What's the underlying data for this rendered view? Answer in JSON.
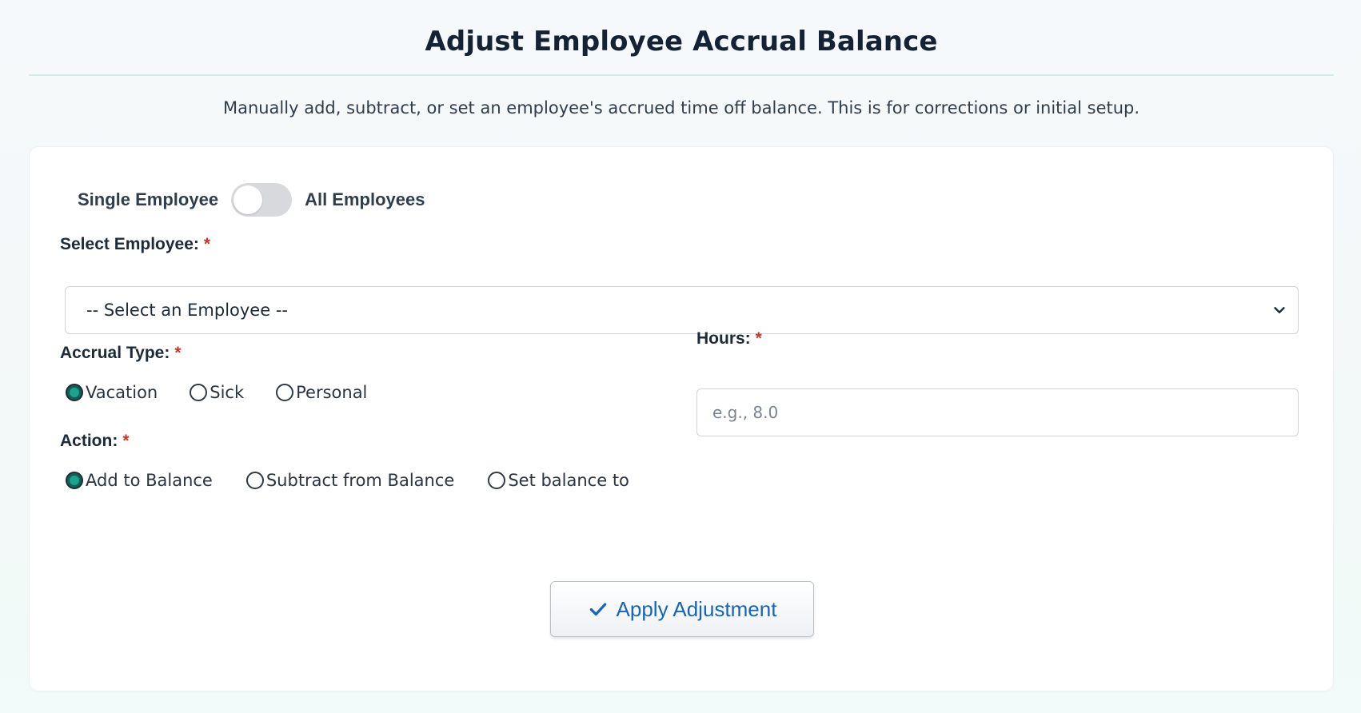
{
  "header": {
    "title": "Adjust Employee Accrual Balance",
    "subtitle": "Manually add, subtract, or set an employee's accrued time off balance. This is for corrections or initial setup."
  },
  "scope_toggle": {
    "left_label": "Single Employee",
    "right_label": "All Employees",
    "state": "single"
  },
  "employee_select": {
    "label": "Select Employee:",
    "required_mark": "*",
    "selected": "-- Select an Employee --"
  },
  "accrual_type": {
    "label": "Accrual Type:",
    "required_mark": "*",
    "options": [
      "Vacation",
      "Sick",
      "Personal"
    ],
    "selected": "Vacation"
  },
  "hours": {
    "label": "Hours:",
    "required_mark": "*",
    "value": "",
    "placeholder": "e.g., 8.0"
  },
  "action": {
    "label": "Action:",
    "required_mark": "*",
    "options": [
      "Add to Balance",
      "Subtract from Balance",
      "Set balance to"
    ],
    "selected": "Add to Balance"
  },
  "submit": {
    "label": "Apply Adjustment",
    "icon": "checkmark-icon"
  },
  "colors": {
    "accent": "#1aa38f",
    "required": "#d0312d",
    "button_text": "#1565c0",
    "title_rule": "#c9efe6"
  }
}
